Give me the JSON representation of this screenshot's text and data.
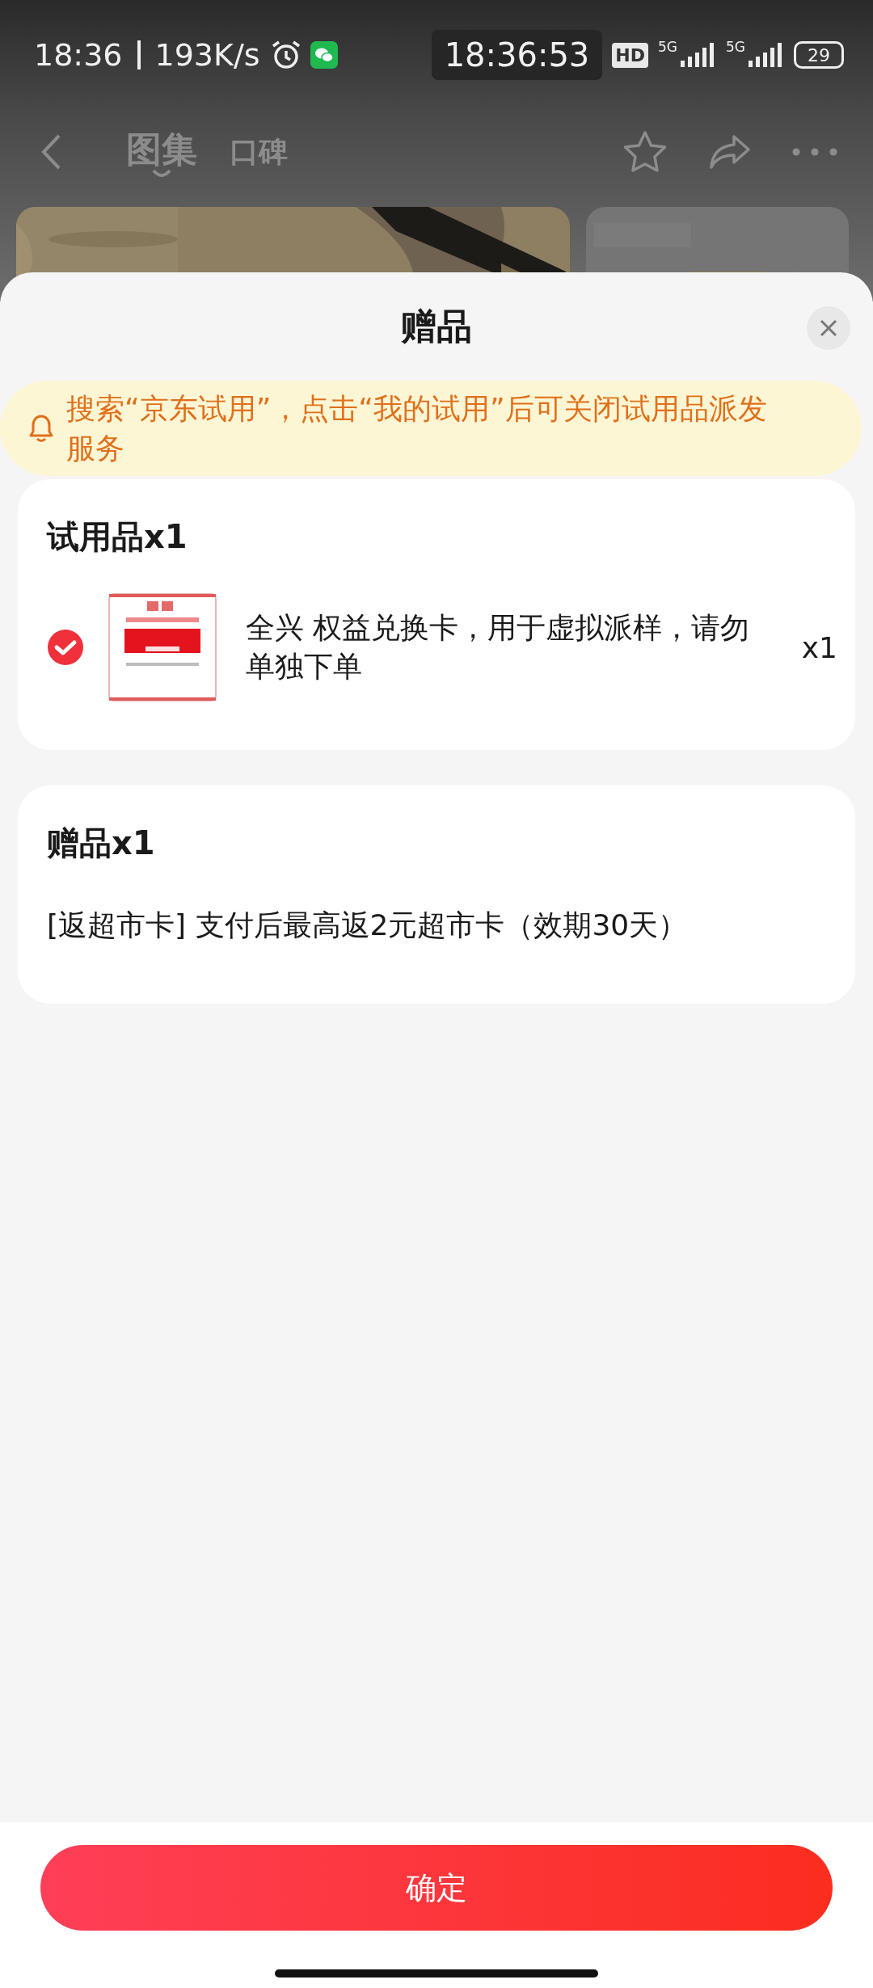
{
  "status_bar": {
    "time": "18:36",
    "speed": "193K/s",
    "clock": "18:36:53",
    "hd": "HD",
    "network_1": "5G",
    "network_2": "5G",
    "battery": "29"
  },
  "nav": {
    "tabs": [
      {
        "label": "图集",
        "selected": true
      },
      {
        "label": "口碑",
        "selected": false
      }
    ]
  },
  "sheet": {
    "title": "赠品",
    "notice": "搜索“京东试用”，点击“我的试用”后可关闭试用品派发服务",
    "sections": [
      {
        "kind": "trial",
        "title": "试用品x1",
        "items": [
          {
            "name": "全兴 权益兑换卡，用于虚拟派样，请勿单独下单",
            "quantity": "x1",
            "checked": true
          }
        ]
      },
      {
        "kind": "gift",
        "title": "赠品x1",
        "text": "[返超市卡] 支付后最高返2元超市卡（效期30天）"
      }
    ],
    "confirm": "确定"
  }
}
